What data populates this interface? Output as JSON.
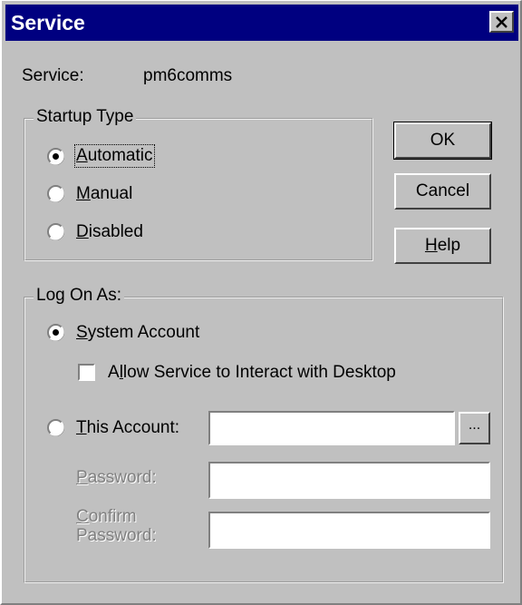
{
  "window": {
    "title": "Service"
  },
  "service": {
    "label": "Service:",
    "value": "pm6comms"
  },
  "startup": {
    "legend": "Startup Type",
    "options": [
      {
        "key": "A",
        "rest": "utomatic",
        "selected": true
      },
      {
        "key": "M",
        "rest": "anual",
        "selected": false
      },
      {
        "key": "D",
        "rest": "isabled",
        "selected": false
      }
    ]
  },
  "buttons": {
    "ok": "OK",
    "cancel": "Cancel",
    "help_key": "H",
    "help_rest": "elp",
    "browse": "..."
  },
  "logon": {
    "legend": "Log On As:",
    "system_key": "S",
    "system_rest": "ystem Account",
    "allow_pre": "A",
    "allow_key": "l",
    "allow_rest": "low Service to Interact with Desktop",
    "this_key": "T",
    "this_rest": "his Account:",
    "password_key": "P",
    "password_rest": "assword:",
    "confirm_key": "C",
    "confirm_rest": "onfirm",
    "confirm_line2": "Password:",
    "account_value": "",
    "password_value": "",
    "confirm_value": "",
    "selected": "system",
    "allow_checked": false
  }
}
